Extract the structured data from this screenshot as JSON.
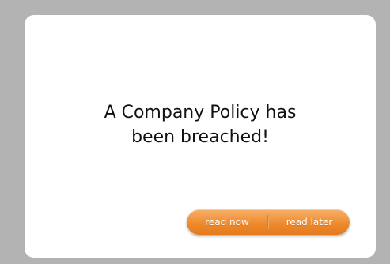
{
  "alert": {
    "message_line1": "A Company Policy has",
    "message_line2": "been breached!"
  },
  "actions": {
    "read_now_label": "read now",
    "read_later_label": "read later"
  },
  "colors": {
    "background": "#b3b3b3",
    "card": "#ffffff",
    "button_orange": "#ef8b2d",
    "text": "#111111"
  }
}
